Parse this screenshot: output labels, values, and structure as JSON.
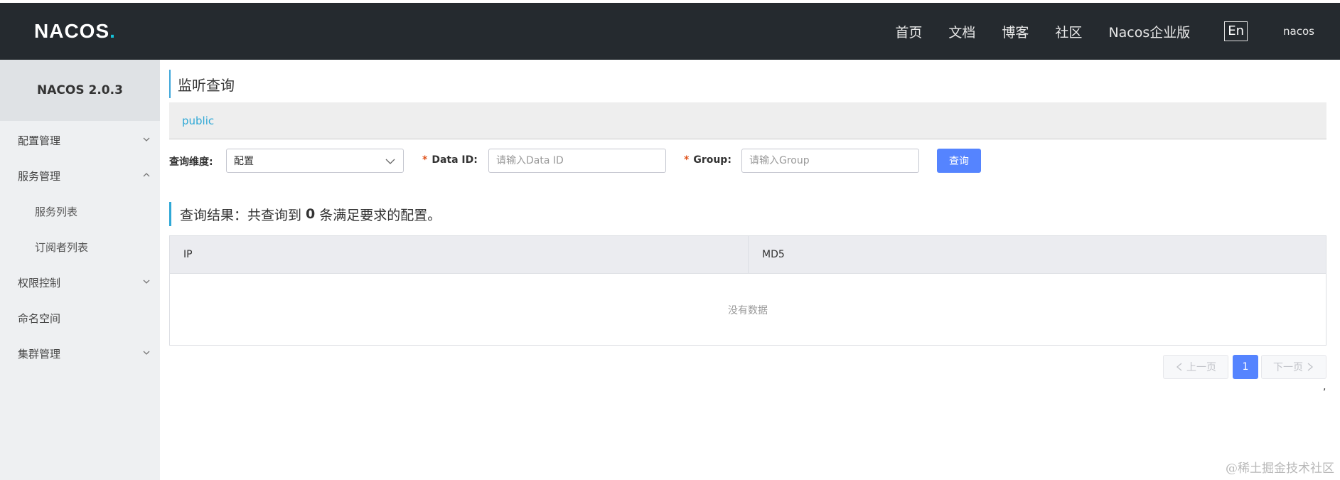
{
  "header": {
    "logo_text": "NACOS",
    "logo_dot": ".",
    "nav": [
      "首页",
      "文档",
      "博客",
      "社区",
      "Nacos企业版"
    ],
    "lang": "En",
    "user": "nacos"
  },
  "sidebar": {
    "version": "NACOS 2.0.3",
    "items": [
      {
        "label": "配置管理",
        "expanded": false
      },
      {
        "label": "服务管理",
        "expanded": true
      },
      {
        "label": "服务列表"
      },
      {
        "label": "订阅者列表"
      },
      {
        "label": "权限控制",
        "expanded": false
      },
      {
        "label": "命名空间"
      },
      {
        "label": "集群管理",
        "expanded": false
      }
    ]
  },
  "main": {
    "title": "监听查询",
    "namespace": "public",
    "form": {
      "dimension_label": "查询维度:",
      "dimension_value": "配置",
      "dataid_label": "Data ID:",
      "dataid_placeholder": "请输入Data ID",
      "group_label": "Group:",
      "group_placeholder": "请输入Group",
      "required_mark": "*",
      "query_button": "查询"
    },
    "result": {
      "prefix": "查询结果：共查询到",
      "count": "0",
      "suffix": "条满足要求的配置。"
    },
    "table": {
      "columns": [
        "IP",
        "MD5"
      ],
      "empty_text": "没有数据"
    },
    "pagination": {
      "prev": "上一页",
      "current": "1",
      "next": "下一页"
    },
    "trailing_mark": ","
  },
  "watermark": "@稀土掘金技术社区",
  "colors": {
    "header_bg": "#252a2f",
    "accent": "#5584ff",
    "link": "#2fa8d6",
    "required": "#e0531c"
  }
}
